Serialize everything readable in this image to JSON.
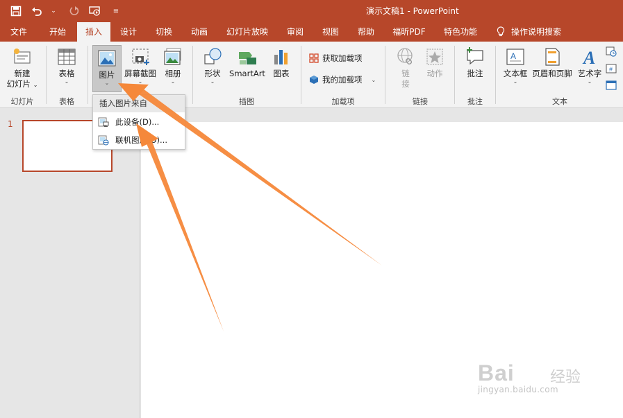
{
  "window": {
    "title": "演示文稿1  -  PowerPoint"
  },
  "qat": {
    "save": "save-icon",
    "undo": "undo-icon",
    "redo": "redo-icon",
    "present": "present-from-start-icon"
  },
  "tabs": [
    {
      "label": "文件"
    },
    {
      "label": "开始"
    },
    {
      "label": "插入",
      "active": true
    },
    {
      "label": "设计"
    },
    {
      "label": "切换"
    },
    {
      "label": "动画"
    },
    {
      "label": "幻灯片放映"
    },
    {
      "label": "审阅"
    },
    {
      "label": "视图"
    },
    {
      "label": "帮助"
    },
    {
      "label": "福昕PDF"
    },
    {
      "label": "特色功能"
    },
    {
      "label": "操作说明搜索"
    }
  ],
  "ribbon": {
    "new_slide": "新建\n幻灯片",
    "new_slide_l1": "新建",
    "new_slide_l2": "幻灯片",
    "table": "表格",
    "picture": "图片",
    "screenshot": "屏幕截图",
    "album": "相册",
    "shapes": "形状",
    "smartart": "SmartArt",
    "chart": "图表",
    "get_addins": "获取加载项",
    "my_addins": "我的加载项",
    "link_l1": "链",
    "link_l2": "接",
    "action": "动作",
    "comment": "批注",
    "textbox": "文本框",
    "header_footer": "页眉和页脚",
    "wordart": "艺术字",
    "groups": {
      "slides": "幻灯片",
      "tables": "表格",
      "illustrations": "插图",
      "addins": "加载项",
      "links": "链接",
      "comments": "批注",
      "text": "文本"
    }
  },
  "dropdown": {
    "header": "插入图片来自",
    "items": [
      {
        "label": "此设备(D)..."
      },
      {
        "label": "联机图片(O)..."
      }
    ]
  },
  "slides_pane": {
    "slide_number": "1"
  },
  "watermark": {
    "brand": "Bai",
    "brand_cn": "经验",
    "url": "jingyan.baidu.com"
  },
  "colors": {
    "accent": "#b7472a",
    "ribbon_bg": "#f3f3f3",
    "arrow": "#f5883a"
  }
}
